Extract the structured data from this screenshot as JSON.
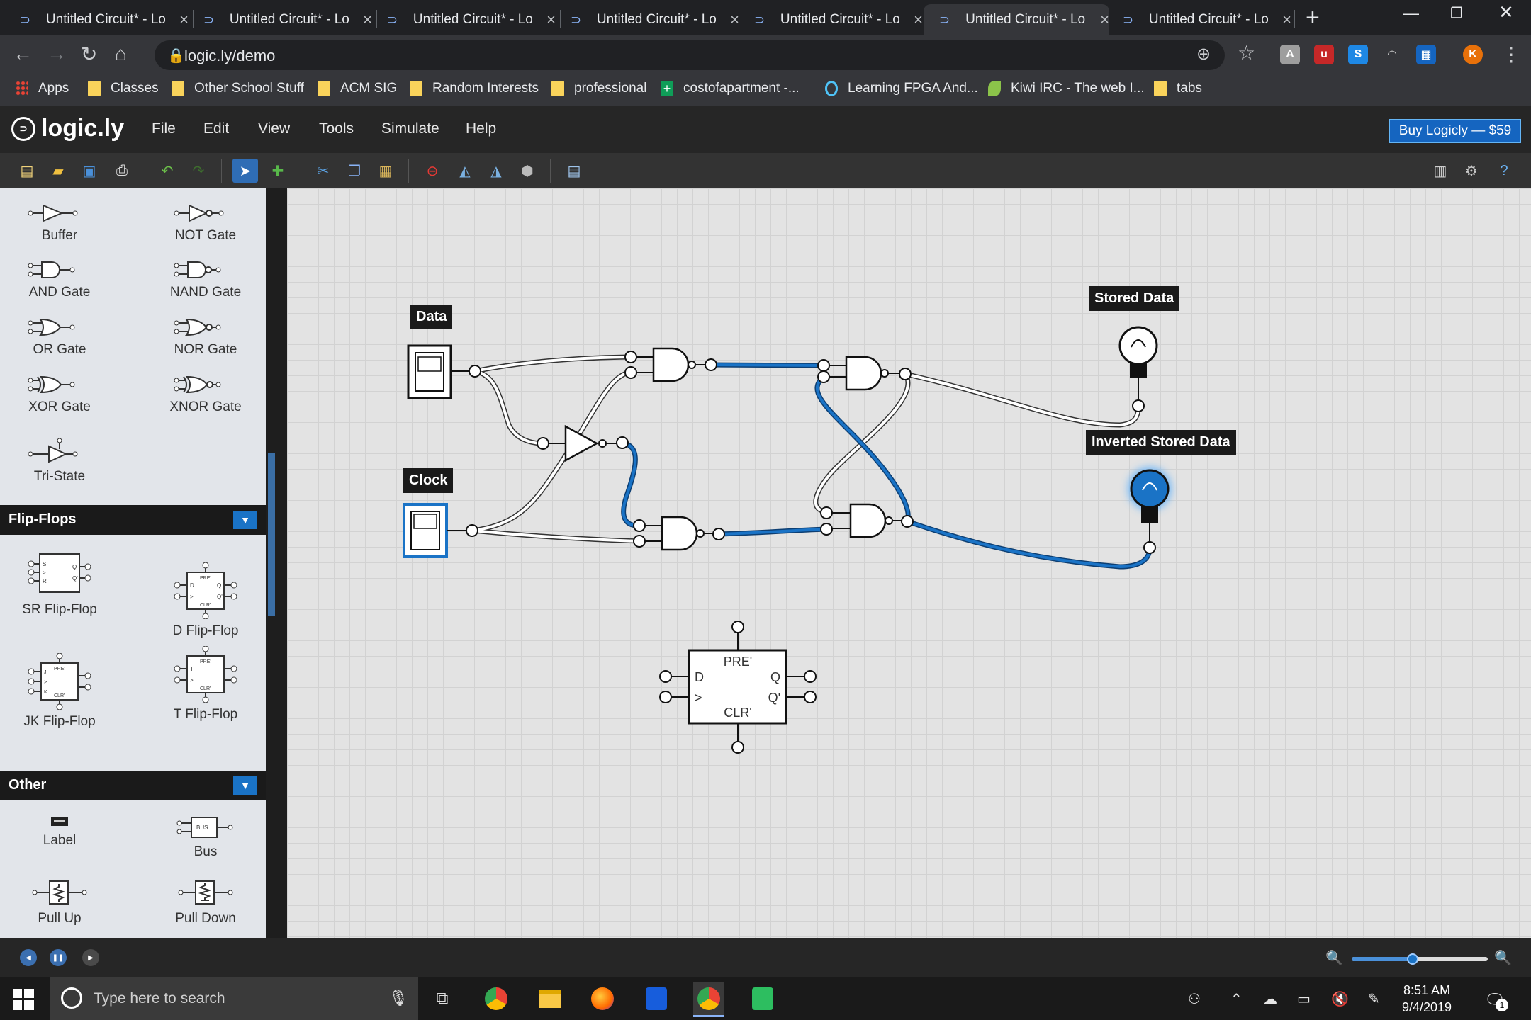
{
  "browser": {
    "tabs": [
      {
        "title": "Untitled Circuit* - Lo"
      },
      {
        "title": "Untitled Circuit* - Lo"
      },
      {
        "title": "Untitled Circuit* - Lo"
      },
      {
        "title": "Untitled Circuit* - Lo"
      },
      {
        "title": "Untitled Circuit* - Lo"
      },
      {
        "title": "Untitled Circuit* - Lo"
      },
      {
        "title": "Untitled Circuit* - Lo"
      }
    ],
    "active_tab": 5,
    "url": "logic.ly/demo",
    "profile_initial": "K",
    "bookmarks": [
      {
        "label": "Apps",
        "icon": "apps-grid-icon"
      },
      {
        "label": "Classes",
        "icon": "folder-icon"
      },
      {
        "label": "Other School Stuff",
        "icon": "folder-icon"
      },
      {
        "label": "ACM SIG",
        "icon": "folder-icon"
      },
      {
        "label": "Random Interests",
        "icon": "folder-icon"
      },
      {
        "label": "professional",
        "icon": "folder-icon"
      },
      {
        "label": "costofapartment -...",
        "icon": "sheets-icon"
      },
      {
        "label": "Learning FPGA And...",
        "icon": "site-icon"
      },
      {
        "label": "Kiwi IRC - The web I...",
        "icon": "kiwi-icon"
      },
      {
        "label": "tabs",
        "icon": "folder-icon"
      }
    ]
  },
  "app": {
    "logo": "logic.ly",
    "menu": [
      "File",
      "Edit",
      "View",
      "Tools",
      "Simulate",
      "Help"
    ],
    "buy_label": "Buy Logicly — $59"
  },
  "sidebar": {
    "gates": [
      {
        "label": "Buffer",
        "icon": "buffer-gate-icon"
      },
      {
        "label": "NOT Gate",
        "icon": "not-gate-icon"
      },
      {
        "label": "AND Gate",
        "icon": "and-gate-icon"
      },
      {
        "label": "NAND Gate",
        "icon": "nand-gate-icon"
      },
      {
        "label": "OR Gate",
        "icon": "or-gate-icon"
      },
      {
        "label": "NOR Gate",
        "icon": "nor-gate-icon"
      },
      {
        "label": "XOR Gate",
        "icon": "xor-gate-icon"
      },
      {
        "label": "XNOR Gate",
        "icon": "xnor-gate-icon"
      },
      {
        "label": "Tri-State",
        "icon": "tri-state-icon"
      }
    ],
    "flipflops_header": "Flip-Flops",
    "flipflops": [
      {
        "label": "SR Flip-Flop"
      },
      {
        "label": "D Flip-Flop"
      },
      {
        "label": "JK Flip-Flop"
      },
      {
        "label": "T Flip-Flop"
      }
    ],
    "other_header": "Other",
    "other": [
      {
        "label": "Label"
      },
      {
        "label": "Bus"
      },
      {
        "label": "Pull Up"
      },
      {
        "label": "Pull Down"
      }
    ]
  },
  "canvas": {
    "labels": {
      "data": "Data",
      "clock": "Clock",
      "stored": "Stored Data",
      "inverted": "Inverted Stored Data"
    },
    "dff": {
      "pre": "PRE'",
      "clr": "CLR'",
      "d": "D",
      "clk": ">",
      "q": "Q",
      "qn": "Q'"
    },
    "stored_bulb_on": false,
    "inverted_bulb_on": true
  },
  "statusbar": {
    "zoom_fraction": 0.45
  },
  "taskbar": {
    "search_placeholder": "Type here to search",
    "time": "8:51 AM",
    "date": "9/4/2019",
    "notification_count": "1"
  },
  "colors": {
    "wire_on": "#1a73c6",
    "wire_off": "#ffffff",
    "accent": "#1565c0"
  }
}
